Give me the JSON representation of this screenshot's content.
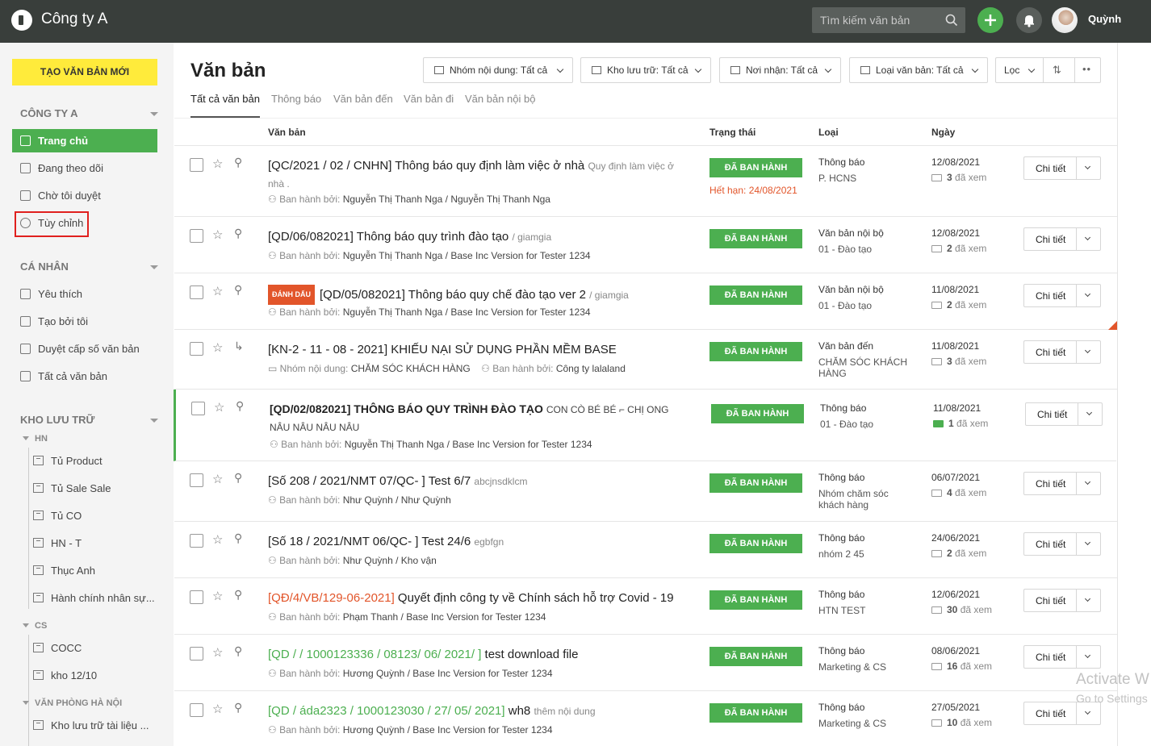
{
  "header": {
    "company": "Công ty A",
    "search_placeholder": "Tìm kiếm văn bản",
    "user": "Quỳnh"
  },
  "sidebar": {
    "new_doc": "TẠO VĂN BẢN MỚI",
    "sec1": "CÔNG TY A",
    "items1": [
      "Trang chủ",
      "Đang theo dõi",
      "Chờ tôi duyệt",
      "Tùy chỉnh"
    ],
    "sec2": "CÁ NHÂN",
    "items2": [
      "Yêu thích",
      "Tạo bởi tôi",
      "Duyệt cấp số văn bản",
      "Tất cả văn bản"
    ],
    "sec3": "KHO LƯU TRỮ",
    "hn": "HN",
    "hn_items": [
      "Tủ Product",
      "Tủ Sale Sale",
      "Tủ CO",
      "HN - T",
      "Thục Anh",
      "Hành chính nhân sự..."
    ],
    "cs": "CS",
    "cs_items": [
      "COCC",
      "kho 12/10"
    ],
    "vp": "VĂN PHÒNG HÀ NỘI",
    "vp_items": [
      "Kho lưu trữ tài liệu ..."
    ]
  },
  "main": {
    "title": "Văn bản",
    "filters": [
      "Nhóm nội dung: Tất cả",
      "Kho lưu trữ: Tất cả",
      "Nơi nhận: Tất cả",
      "Loại văn bản: Tất cả",
      "Lọc"
    ],
    "tabs": [
      "Tất cả văn bản",
      "Thông báo",
      "Văn bản đến",
      "Văn bản đi",
      "Văn bản nội bộ"
    ],
    "columns": {
      "doc": "Văn bản",
      "status": "Trạng thái",
      "type": "Loại",
      "date": "Ngày"
    },
    "status_label": "ĐÃ BAN HÀNH",
    "detail_label": "Chi tiết",
    "views_suffix": "đã xem",
    "issued_by": "Ban hành bởi:",
    "group_label": "Nhóm nội dung:",
    "mark_label": "ĐÁNH DẤU",
    "rows": [
      {
        "title": "[QC/2021 / 02 / CNHN] Thông báo quy định làm việc ở nhà",
        "excerpt": "Quy định làm việc ở nhà .",
        "by": "Nguyễn Thị Thanh Nga / Nguyễn Thị Thanh Nga",
        "expire": "Hết hạn: 24/08/2021",
        "type": "Thông báo",
        "sub": "P. HCNS",
        "date": "12/08/2021",
        "views": "3"
      },
      {
        "title": "[QD/06/082021] Thông báo quy trình đào tạo",
        "excerpt": "/ giamgia",
        "by": "Nguyễn Thị Thanh Nga / Base Inc Version for Tester 1234",
        "type": "Văn bản nội bộ",
        "sub": "01 - Đào tạo",
        "date": "12/08/2021",
        "views": "2"
      },
      {
        "title": "[QD/05/082021] Thông báo quy chế đào tạo ver 2",
        "excerpt": "/ giamgia",
        "by": "Nguyễn Thị Thanh Nga / Base Inc Version for Tester 1234",
        "type": "Văn bản nội bộ",
        "sub": "01 - Đào tạo",
        "date": "11/08/2021",
        "views": "2"
      },
      {
        "title": "[KN-2 - 11 - 08 - 2021] KHIẾU NẠI SỬ DỤNG PHẦN MỀM BASE",
        "excerpt": "",
        "group": "CHĂM SÓC KHÁCH HÀNG",
        "by": "Công ty lalaland",
        "type": "Văn bản đến",
        "sub": "CHĂM SÓC KHÁCH HÀNG",
        "date": "11/08/2021",
        "views": "3"
      },
      {
        "title": "[QD/02/082021] THÔNG BÁO QUY TRÌNH ĐÀO TẠO",
        "excerpt": "CON CÒ BÉ BÉ ⌐ CHỊ ONG NÂU NÂU NÂU NÂU",
        "by": "Nguyễn Thị Thanh Nga / Base Inc Version for Tester 1234",
        "type": "Thông báo",
        "sub": "01 - Đào tạo",
        "date": "11/08/2021",
        "views": "1"
      },
      {
        "title": "[Số 208 / 2021/NMT 07/QC- ] Test 6/7",
        "excerpt": "abcjnsdklcm",
        "by": "Như Quỳnh / Như Quỳnh",
        "type": "Thông báo",
        "sub": "Nhóm chăm sóc khách hàng",
        "date": "06/07/2021",
        "views": "4"
      },
      {
        "title": "[Số 18 / 2021/NMT 06/QC- ] Test 24/6",
        "excerpt": "egbfgn",
        "by": "Như Quỳnh / Kho vận",
        "type": "Thông báo",
        "sub": "nhóm 2 45",
        "date": "24/06/2021",
        "views": "2"
      },
      {
        "title_pre": "[QĐ/4/VB/129-06-2021]",
        "title": " Quyết định công ty về Chính sách hỗ trợ Covid - 19",
        "excerpt": "",
        "by": "Phạm Thanh / Base Inc Version for Tester 1234",
        "type": "Thông báo",
        "sub": "HTN TEST",
        "date": "12/06/2021",
        "views": "30"
      },
      {
        "title_pre": "[QD / / 1000123336 / 08123/ 06/ 2021/ ]",
        "title": " test download file",
        "excerpt": "",
        "by": "Hương Quỳnh / Base Inc Version for Tester 1234",
        "type": "Thông báo",
        "sub": "Marketing & CS",
        "date": "08/06/2021",
        "views": "16"
      },
      {
        "title_pre": "[QD / áda2323 / 1000123030 / 27/ 05/ 2021]",
        "title": " wh8",
        "excerpt": "thêm nội dung",
        "by": "Hương Quỳnh / Base Inc Version for Tester 1234",
        "type": "Thông báo",
        "sub": "Marketing & CS",
        "date": "27/05/2021",
        "views": "10"
      }
    ]
  },
  "watermark": {
    "line1": "Activate W",
    "line2": "Go to Settings"
  }
}
